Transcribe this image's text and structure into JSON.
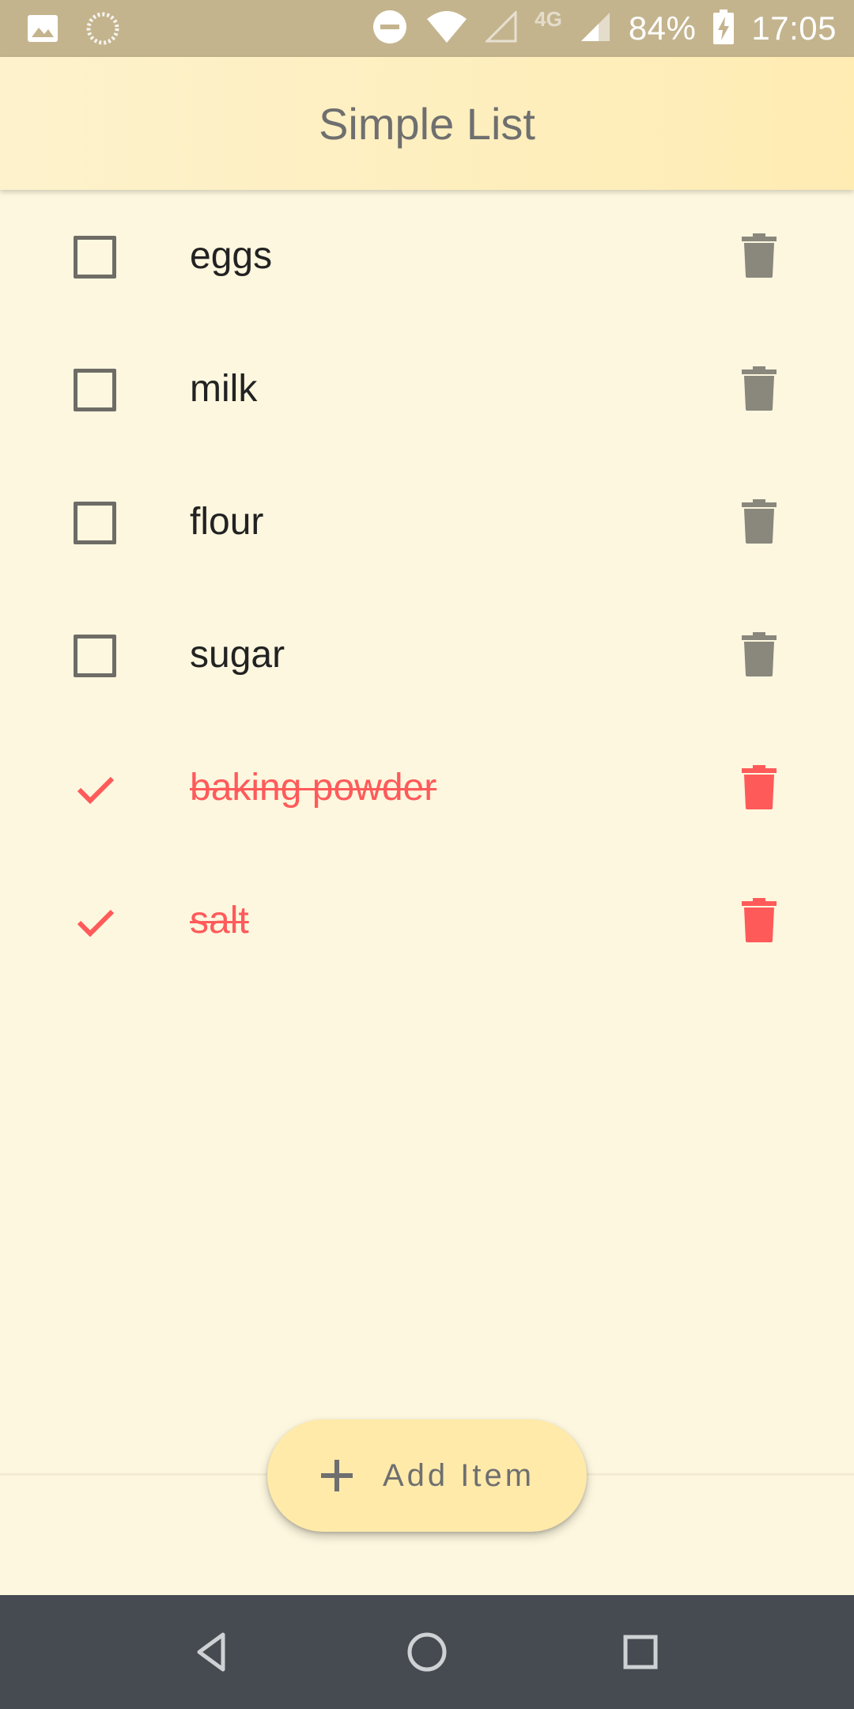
{
  "status_bar": {
    "battery": "84%",
    "time": "17:05",
    "network": "4G",
    "icons": [
      "image-icon",
      "loading-icon",
      "do-not-disturb-icon",
      "wifi-icon",
      "signal-empty-icon",
      "signal-icon",
      "battery-charging-icon"
    ]
  },
  "app_bar": {
    "title": "Simple List"
  },
  "list": {
    "items": [
      {
        "label": "eggs",
        "checked": false
      },
      {
        "label": "milk",
        "checked": false
      },
      {
        "label": "flour",
        "checked": false
      },
      {
        "label": "sugar",
        "checked": false
      },
      {
        "label": "baking powder",
        "checked": true
      },
      {
        "label": "salt",
        "checked": true
      }
    ]
  },
  "fab": {
    "label": "Add Item",
    "icon": "plus-icon"
  },
  "colors": {
    "status_bar": "#c4b48e",
    "app_bar": "#ffecb3",
    "background": "#fdf7df",
    "checked_accent": "#ff5a5a",
    "icon_gray": "#8a877c",
    "nav_bar": "#454b51"
  },
  "nav_bar": {
    "icons": [
      "back-icon",
      "home-icon",
      "recents-icon"
    ]
  }
}
